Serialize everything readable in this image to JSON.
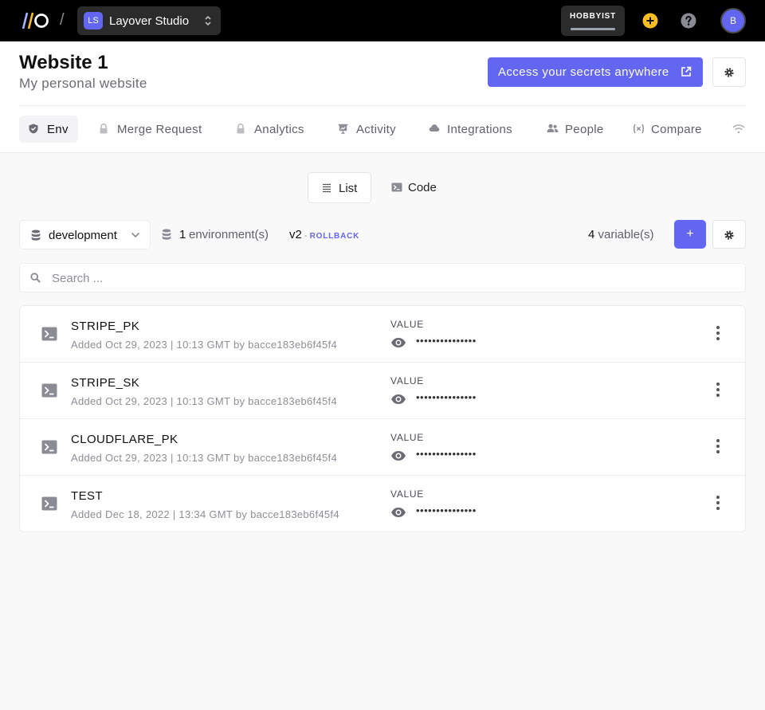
{
  "topbar": {
    "org_initials": "LS",
    "org_name": "Layover Studio",
    "plan": "HOBBYIST",
    "plan_usage_percent": 100,
    "user_initial": "B"
  },
  "header": {
    "title": "Website 1",
    "subtitle": "My personal website",
    "promo_label": "Access your secrets anywhere"
  },
  "tabs": [
    {
      "label": "Env",
      "active": true
    },
    {
      "label": "Merge Request"
    },
    {
      "label": "Analytics"
    },
    {
      "label": "Activity"
    },
    {
      "label": "Integrations"
    },
    {
      "label": "People"
    },
    {
      "label": "Compare"
    }
  ],
  "view_toggle": {
    "list": "List",
    "code": "Code"
  },
  "controls": {
    "environment": "development",
    "env_count": "1",
    "env_count_label": "environment(s)",
    "version": "v2",
    "version_sep": " - ",
    "rollback": "ROLLBACK",
    "var_count": "4",
    "var_count_label": "variable(s)",
    "add_label": "+"
  },
  "search": {
    "placeholder": "Search ..."
  },
  "variables": [
    {
      "key": "STRIPE_PK",
      "meta": "Added Oct 29, 2023 | 10:13 GMT by bacce183eb6f45f4",
      "value_label": "VALUE",
      "masked": "•••••••••••••••"
    },
    {
      "key": "STRIPE_SK",
      "meta": "Added Oct 29, 2023 | 10:13 GMT by bacce183eb6f45f4",
      "value_label": "VALUE",
      "masked": "•••••••••••••••"
    },
    {
      "key": "CLOUDFLARE_PK",
      "meta": "Added Oct 29, 2023 | 10:13 GMT by bacce183eb6f45f4",
      "value_label": "VALUE",
      "masked": "•••••••••••••••"
    },
    {
      "key": "TEST",
      "meta": "Added Dec 18, 2022 | 13:34 GMT by bacce183eb6f45f4",
      "value_label": "VALUE",
      "masked": "•••••••••••••••"
    }
  ],
  "colors": {
    "accent": "#6366f1",
    "warning": "#fbbf24",
    "topbar": "#000000"
  }
}
